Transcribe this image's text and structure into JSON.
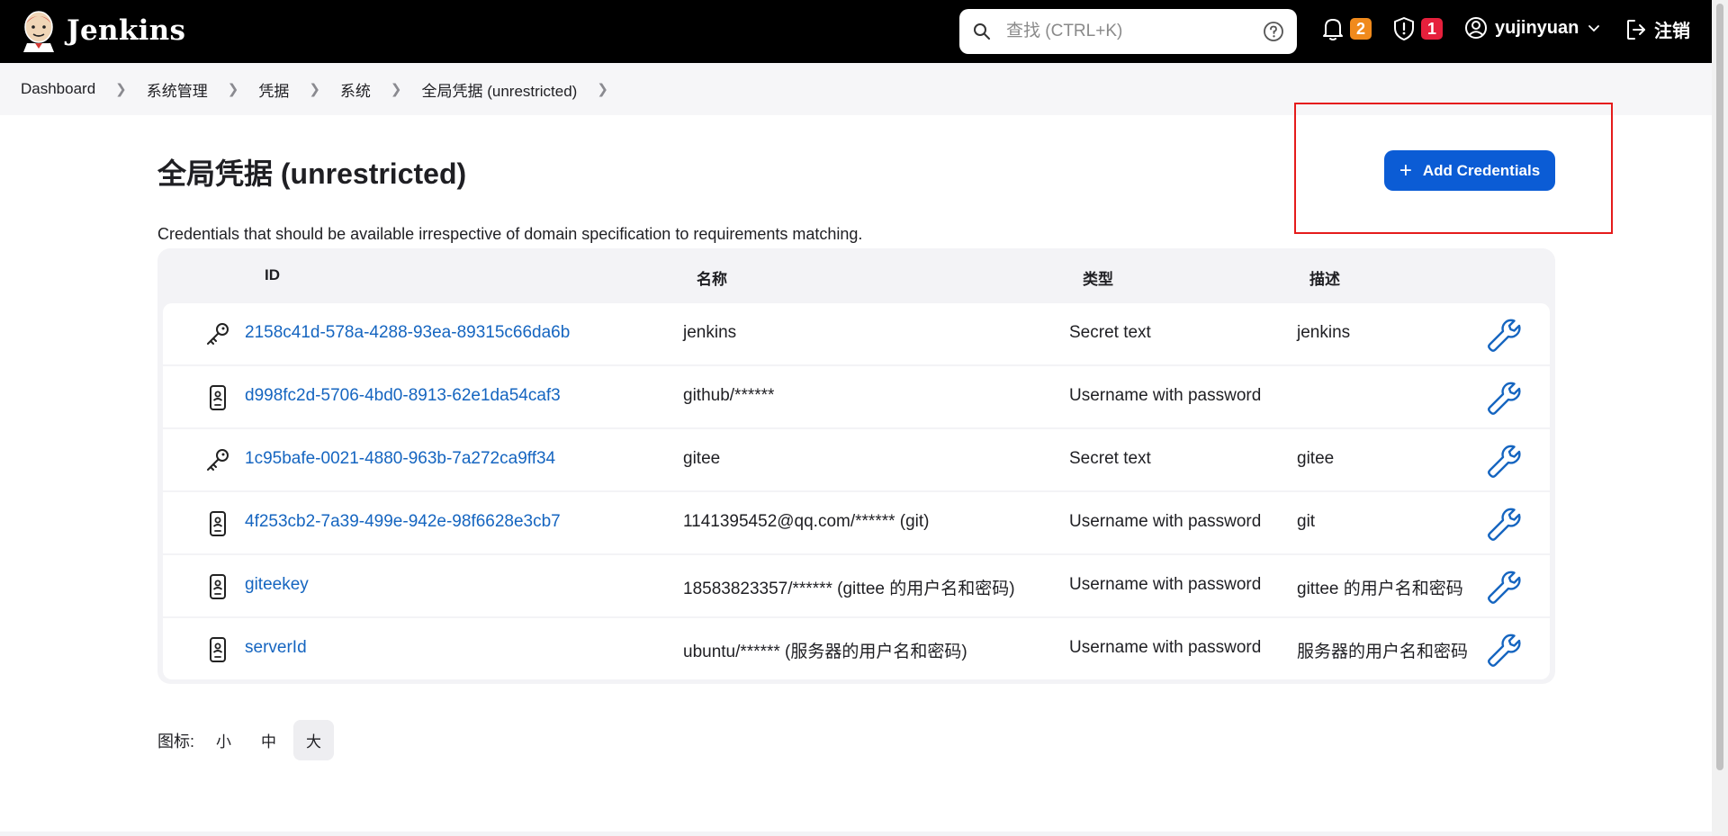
{
  "header": {
    "app_name": "Jenkins",
    "search_placeholder": "查找 (CTRL+K)",
    "notifications_count": "2",
    "security_count": "1",
    "user_name": "yujinyuan",
    "logout_label": "注销"
  },
  "breadcrumb": [
    "Dashboard",
    "系统管理",
    "凭据",
    "系统",
    "全局凭据 (unrestricted)"
  ],
  "page": {
    "title": "全局凭据 (unrestricted)",
    "add_button_label": "Add Credentials",
    "description": "Credentials that should be available irrespective of domain specification to requirements matching."
  },
  "table": {
    "columns": [
      "ID",
      "名称",
      "类型",
      "描述"
    ],
    "rows": [
      {
        "icon": "key-icon",
        "id": "2158c41d-578a-4288-93ea-89315c66da6b",
        "name": "jenkins",
        "type": "Secret text",
        "description": "jenkins"
      },
      {
        "icon": "user-password-icon",
        "id": "d998fc2d-5706-4bd0-8913-62e1da54caf3",
        "name": "github/******",
        "type": "Username with password",
        "description": ""
      },
      {
        "icon": "key-icon",
        "id": "1c95bafe-0021-4880-963b-7a272ca9ff34",
        "name": "gitee",
        "type": "Secret text",
        "description": "gitee"
      },
      {
        "icon": "user-password-icon",
        "id": "4f253cb2-7a39-499e-942e-98f6628e3cb7",
        "name": "1141395452@qq.com/****** (git)",
        "type": "Username with password",
        "description": "git"
      },
      {
        "icon": "user-password-icon",
        "id": "giteekey",
        "name": "18583823357/****** (gittee 的用户名和密码)",
        "type": "Username with password",
        "description": "gittee 的用户名和密码"
      },
      {
        "icon": "user-password-icon",
        "id": "serverId",
        "name": "ubuntu/****** (服务器的用户名和密码)",
        "type": "Username with password",
        "description": "服务器的用户名和密码"
      }
    ]
  },
  "icon_size": {
    "label": "图标:",
    "options": [
      "小",
      "中",
      "大"
    ],
    "selected": "大"
  },
  "colors": {
    "header_bg": "#000000",
    "accent_blue": "#0b5cd5",
    "link_blue": "#1565c0",
    "highlight_red": "#e51b1b",
    "badge_orange": "#f08a1c",
    "badge_red": "#e6203c"
  }
}
